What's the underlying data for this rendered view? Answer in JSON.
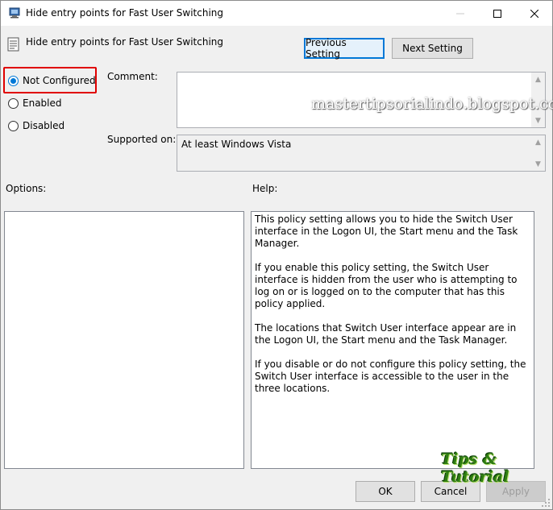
{
  "window": {
    "title": "Hide entry points for Fast User Switching"
  },
  "header": {
    "setting_name": "Hide entry points for Fast User Switching",
    "previous_label": "Previous Setting",
    "next_label": "Next Setting"
  },
  "state": {
    "options": [
      {
        "label": "Not Configured",
        "checked": true
      },
      {
        "label": "Enabled",
        "checked": false
      },
      {
        "label": "Disabled",
        "checked": false
      }
    ]
  },
  "comment": {
    "label": "Comment:",
    "value": ""
  },
  "supported": {
    "label": "Supported on:",
    "value": "At least Windows Vista"
  },
  "options_panel": {
    "label": "Options:"
  },
  "help_panel": {
    "label": "Help:",
    "paragraphs": [
      "This policy setting allows you to hide the Switch User interface in the Logon UI, the Start menu and the Task Manager.",
      "If you enable this policy setting, the Switch User interface is hidden from the user who is attempting to log on or is logged on to the computer that has this policy applied.",
      "The locations that Switch User interface appear are in the Logon UI, the Start menu and the Task Manager.",
      "If you disable or do not configure this policy setting, the Switch User interface is accessible to the user in the three locations."
    ]
  },
  "footer": {
    "ok_label": "OK",
    "cancel_label": "Cancel",
    "apply_label": "Apply"
  },
  "overlays": {
    "watermark": "mastertipsorialindo.blogspot.com",
    "logo": "Tips & Tutorial"
  },
  "colors": {
    "accent": "#0078d7",
    "highlight_box": "#e00000"
  }
}
